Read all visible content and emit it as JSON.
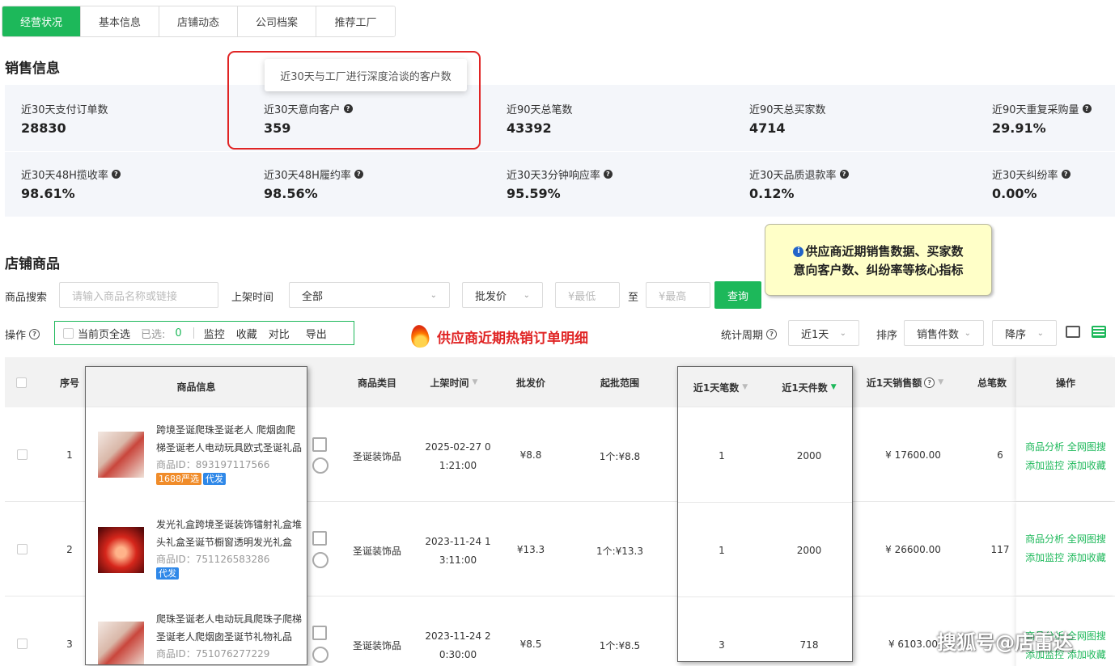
{
  "tabs": [
    {
      "label": "经营状况",
      "active": true
    },
    {
      "label": "基本信息"
    },
    {
      "label": "店铺动态"
    },
    {
      "label": "公司档案"
    },
    {
      "label": "推荐工厂"
    }
  ],
  "sales": {
    "title": "销售信息",
    "tooltip": "近30天与工厂进行深度洽谈的客户数",
    "stats_row1": [
      {
        "label": "近30天支付订单数",
        "value": "28830"
      },
      {
        "label": "近30天意向客户",
        "value": "359"
      },
      {
        "label": "近90天总笔数",
        "value": "43392"
      },
      {
        "label": "近90天总买家数",
        "value": "4714"
      },
      {
        "label": "近90天重复采购量",
        "value": "29.91%"
      }
    ],
    "stats_row2": [
      {
        "label": "近30天48H揽收率",
        "value": "98.61%"
      },
      {
        "label": "近30天48H履约率",
        "value": "98.56%"
      },
      {
        "label": "近30天3分钟响应率",
        "value": "95.59%"
      },
      {
        "label": "近30天品质退款率",
        "value": "0.12%"
      },
      {
        "label": "近30天纠纷率",
        "value": "0.00%"
      }
    ]
  },
  "callout": {
    "line1": "供应商近期销售数据、买家数",
    "line2": "意向客户数、纠纷率等核心指标"
  },
  "store": {
    "title": "店铺商品",
    "search_label": "商品搜索",
    "search_placeholder": "请输入商品名称或链接",
    "listing_label": "上架时间",
    "listing_value": "全部",
    "price_select": "批发价",
    "min_placeholder": "¥最低",
    "to_label": "至",
    "max_placeholder": "¥最高",
    "query_button": "查询",
    "ops_label": "操作",
    "select_all": "当前页全选",
    "selected_label": "已选:",
    "selected_count": "0",
    "op_monitor": "监控",
    "op_collect": "收藏",
    "op_compare": "对比",
    "op_export": "导出",
    "hot_caption": "供应商近期热销订单明细",
    "period_label": "统计周期",
    "period_value": "近1天",
    "sort_label": "排序",
    "sort_value": "销售件数",
    "order_value": "降序"
  },
  "table": {
    "headers": {
      "index": "序号",
      "product": "商品信息",
      "category": "商品类目",
      "listed": "上架时间",
      "price": "批发价",
      "range": "起批范围",
      "orders": "近1天笔数",
      "pieces": "近1天件数",
      "sales": "近1天销售额",
      "total": "总笔数",
      "ops": "操作"
    },
    "rows": [
      {
        "index": "1",
        "title1": "跨境圣诞爬珠圣诞老人 爬烟囱爬",
        "title2": "梯圣诞老人电动玩具欧式圣诞礼品",
        "pid": "商品ID：893197117566",
        "tags": [
          "1688严选",
          "代发"
        ],
        "category": "圣诞装饰品",
        "listed1": "2025-02-27 0",
        "listed2": "1:21:00",
        "price": "¥8.8",
        "range": "1个:¥8.8",
        "orders": "1",
        "pieces": "2000",
        "sales": "¥ 17600.00",
        "total": "6"
      },
      {
        "index": "2",
        "title1": "发光礼盒跨境圣诞装饰镭射礼盒堆",
        "title2": "头礼盒圣诞节橱窗透明发光礼盒",
        "pid": "商品ID：751126583286",
        "tags": [
          "代发"
        ],
        "category": "圣诞装饰品",
        "listed1": "2023-11-24 1",
        "listed2": "3:11:00",
        "price": "¥13.3",
        "range": "1个:¥13.3",
        "orders": "1",
        "pieces": "2000",
        "sales": "¥ 26600.00",
        "total": "117"
      },
      {
        "index": "3",
        "title1": "爬珠圣诞老人电动玩具爬珠子爬梯",
        "title2": "圣诞老人爬烟囱圣诞节礼物礼品",
        "pid": "商品ID：751076277229",
        "tags": [],
        "category": "圣诞装饰品",
        "listed1": "2023-11-24 2",
        "listed2": "0:30:00",
        "price": "¥8.5",
        "range": "1个:¥8.5",
        "orders": "3",
        "pieces": "718",
        "sales": "¥ 6103.00",
        "total": ""
      }
    ],
    "row_ops": {
      "analyze": "商品分析",
      "search_web": "全网图搜",
      "add_monitor": "添加监控",
      "add_collect": "添加收藏"
    }
  },
  "watermark": "搜狐号@店雷达"
}
